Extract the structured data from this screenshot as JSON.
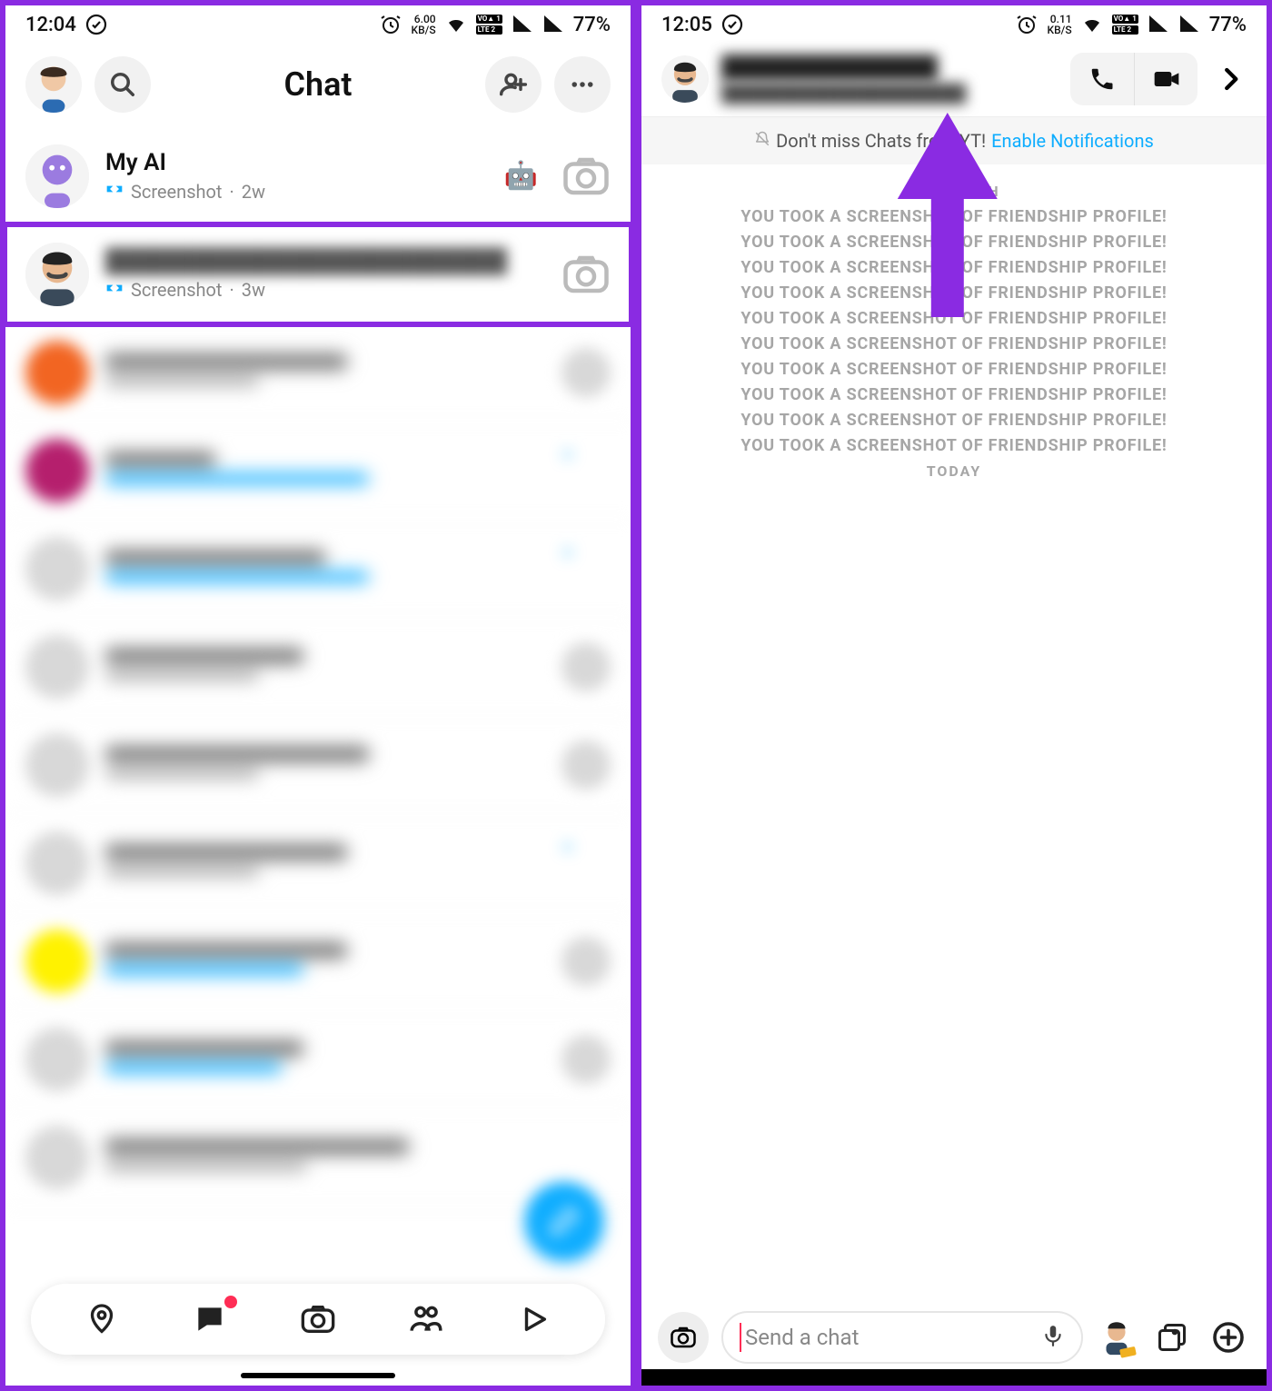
{
  "left": {
    "status": {
      "time": "12:04",
      "speed_top": "6.00",
      "speed_bottom": "KB/S",
      "vo1": "VO▲ 1",
      "vo2": "LTE 2",
      "battery": "77%"
    },
    "header": {
      "title": "Chat"
    },
    "rows": [
      {
        "name": "My AI",
        "sub_label": "Screenshot",
        "sub_time": "2w",
        "emoji": "🤖"
      },
      {
        "name": "",
        "sub_label": "Screenshot",
        "sub_time": "3w",
        "emoji": ""
      }
    ]
  },
  "right": {
    "status": {
      "time": "12:05",
      "speed_top": "0.11",
      "speed_bottom": "KB/S",
      "vo1": "VO▲ 1",
      "vo2": "LTE 2",
      "battery": "77%"
    },
    "notif": {
      "text": "Don't miss Chats from YT! ",
      "link": "Enable Notifications"
    },
    "dates": {
      "d1": "JUNE 12TH",
      "d2": "TODAY"
    },
    "sys_line": "YOU TOOK A SCREENSHOT OF FRIENDSHIP PROFILE!",
    "sys_count": 10,
    "input": {
      "placeholder": "Send a chat"
    }
  }
}
